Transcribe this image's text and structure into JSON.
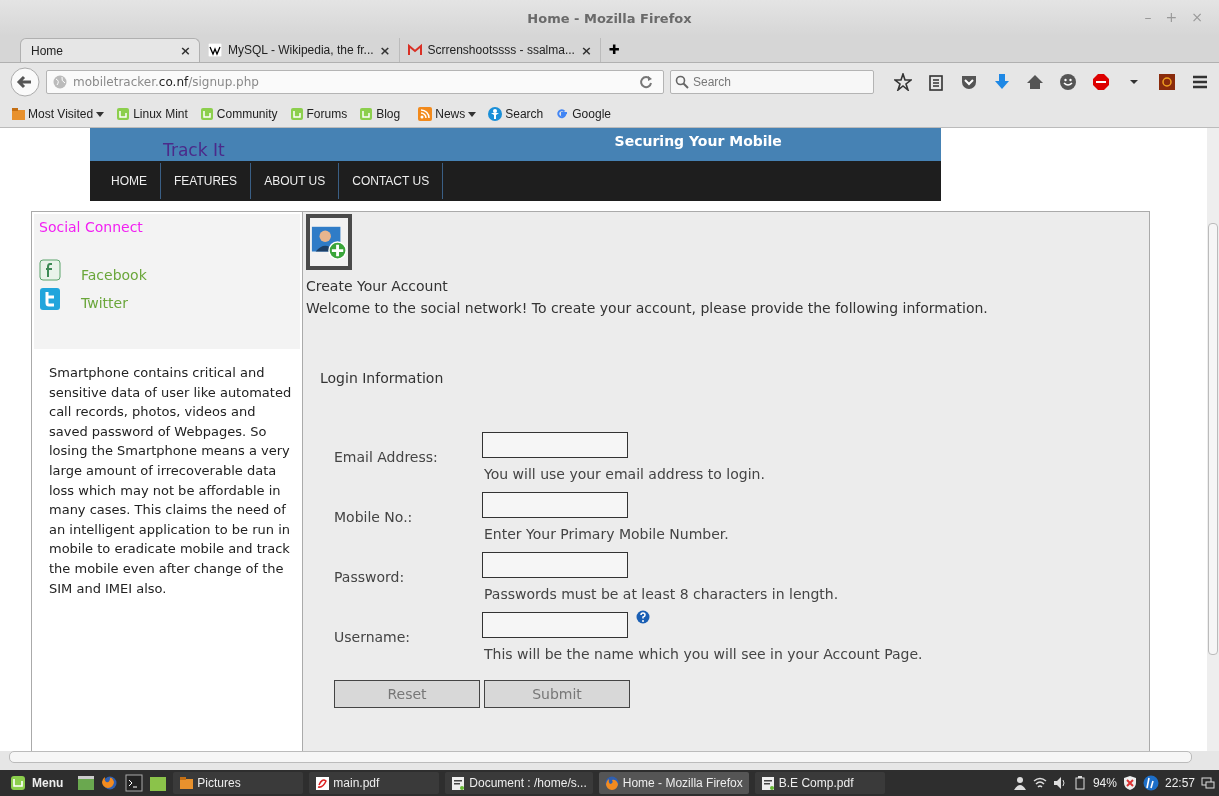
{
  "window": {
    "title": "Home - Mozilla Firefox",
    "controls": [
      "–",
      "+",
      "×"
    ]
  },
  "tabs": [
    {
      "label": "Home",
      "kind": "blank",
      "selected": true,
      "close": "×"
    },
    {
      "label": "MySQL - Wikipedia, the fr...",
      "kind": "wiki",
      "selected": false,
      "close": "×"
    },
    {
      "label": "Scrrenshootssss - ssalma...",
      "kind": "mail",
      "selected": false,
      "close": "×"
    }
  ],
  "new_tab": "✚",
  "address": {
    "host": "mobiletracker.",
    "domain": "co.nf",
    "path": "/signup.php"
  },
  "search": {
    "placeholder": "Search"
  },
  "bookmarks": [
    {
      "label": "Most Visited",
      "kind": "folder",
      "dropdown": true
    },
    {
      "label": "Linux Mint",
      "kind": "mint",
      "dropdown": false
    },
    {
      "label": "Community",
      "kind": "mint",
      "dropdown": false
    },
    {
      "label": "Forums",
      "kind": "mint",
      "dropdown": false
    },
    {
      "label": "Blog",
      "kind": "mint",
      "dropdown": false
    },
    {
      "label": "News",
      "kind": "rss",
      "dropdown": true
    },
    {
      "label": "Search",
      "kind": "person",
      "dropdown": false
    },
    {
      "label": "Google",
      "kind": "google",
      "dropdown": false
    }
  ],
  "site": {
    "brand": "Track It",
    "slogan": "Securing Your Mobile",
    "nav": [
      "HOME",
      "FEATURES",
      "ABOUT US",
      "CONTACT US"
    ]
  },
  "sidebar": {
    "title": "Social Connect",
    "links": [
      {
        "label": "Facebook",
        "kind": "facebook"
      },
      {
        "label": "Twitter",
        "kind": "twitter"
      }
    ],
    "text": "Smartphone contains critical and sensitive data of user like automated call records, photos, videos and saved password of Webpages. So losing the Smartphone means a very large amount of irrecoverable data loss which may not be affordable in many cases. This claims the need of an intelligent application to be run in mobile to eradicate mobile and track the mobile even after change of the SIM and IMEI also."
  },
  "form": {
    "title": "Create Your Account",
    "intro": "Welcome to the social network! To create your account, please provide the following information.",
    "section": "Login Information",
    "fields": [
      {
        "label": "Email Address:",
        "hint": "You will use your email address to login.",
        "help": false
      },
      {
        "label": "Mobile No.:",
        "hint": "Enter Your Primary Mobile Number.",
        "help": false
      },
      {
        "label": "Password:",
        "hint": "Passwords must be at least 8 characters in length.",
        "help": false
      },
      {
        "label": "Username:",
        "hint": "This will be the name which you will see in your Account Page.",
        "help": true
      }
    ],
    "buttons": [
      "Reset",
      "Submit"
    ]
  },
  "taskbar": {
    "menu": "Menu",
    "windows": [
      {
        "label": "Pictures",
        "kind": "folder",
        "selected": false
      },
      {
        "label": "main.pdf",
        "kind": "pdf",
        "selected": false
      },
      {
        "label": "Document : /home/s...",
        "kind": "tex",
        "selected": false
      },
      {
        "label": "Home - Mozilla Firefox",
        "kind": "firefox",
        "selected": true
      },
      {
        "label": "B.E Comp.pdf",
        "kind": "tex",
        "selected": false
      }
    ],
    "battery": "94%",
    "clock": "22:57"
  }
}
